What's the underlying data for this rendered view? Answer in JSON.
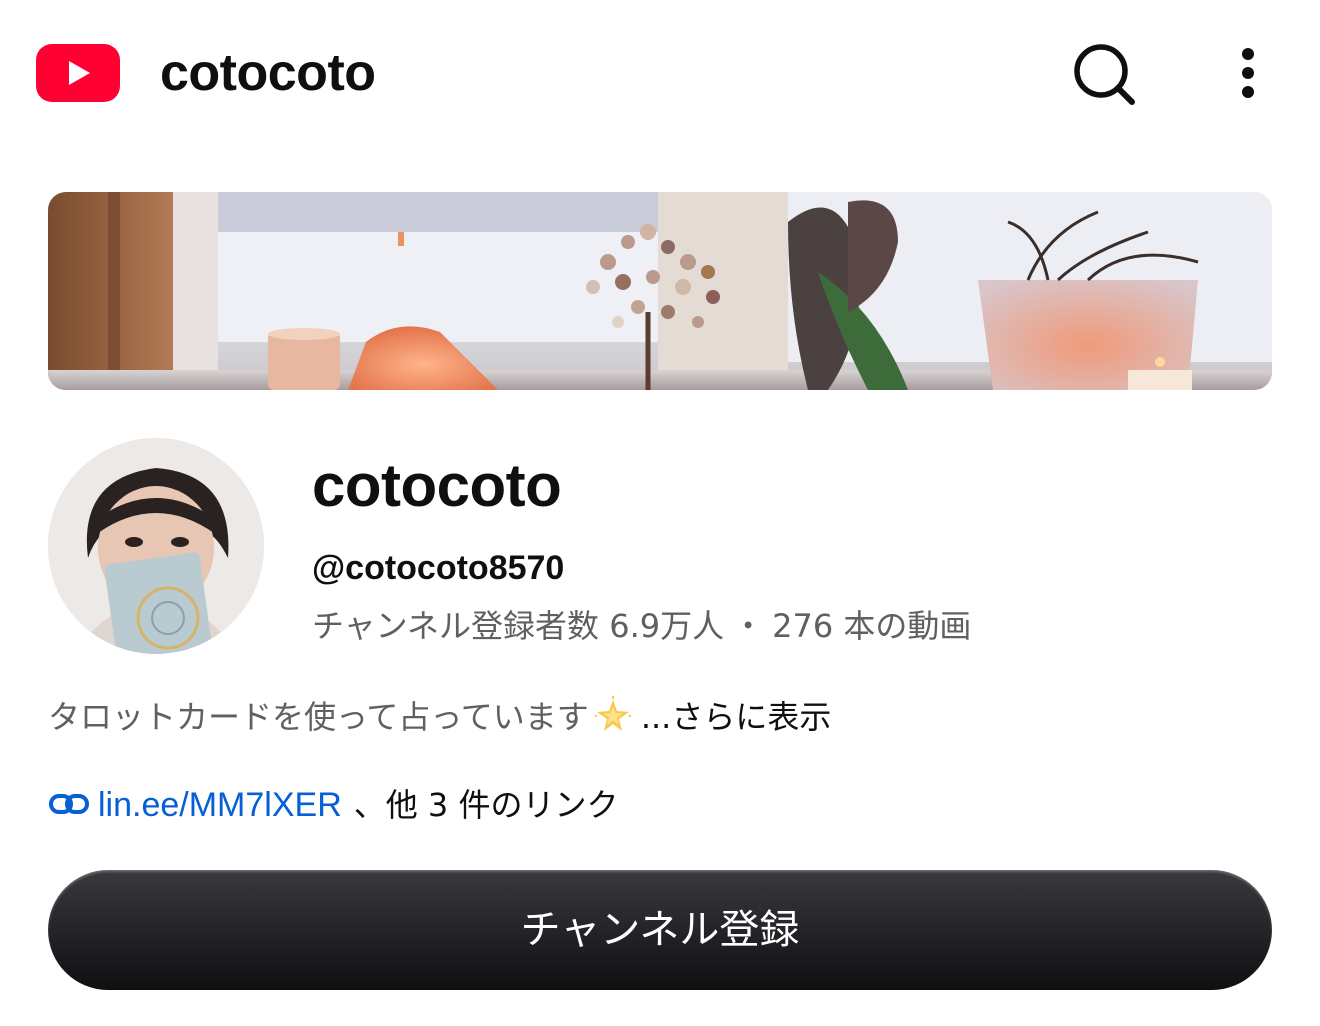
{
  "header": {
    "logo_icon": "youtube-logo-icon",
    "title": "cotocoto",
    "search_icon": "search-icon",
    "more_icon": "more-vertical-icon"
  },
  "channel": {
    "name": "cotocoto",
    "handle": "@cotocoto8570",
    "subscribers": "チャンネル登録者数 6.9万人",
    "separator": "・",
    "videos": "276 本の動画",
    "description": "タロットカードを使って占っています",
    "description_emoji": "glowing-star-icon",
    "more_label": "...さらに表示",
    "link_icon": "link-icon",
    "link_url": "lin.ee/MM7lXER",
    "link_others": "、他 3 件のリンク",
    "subscribe_label": "チャンネル登録"
  },
  "colors": {
    "brand_red": "#ff0033",
    "link_blue": "#065fd4",
    "secondary_text": "#606060",
    "button_dark": "#0f0f0f"
  }
}
